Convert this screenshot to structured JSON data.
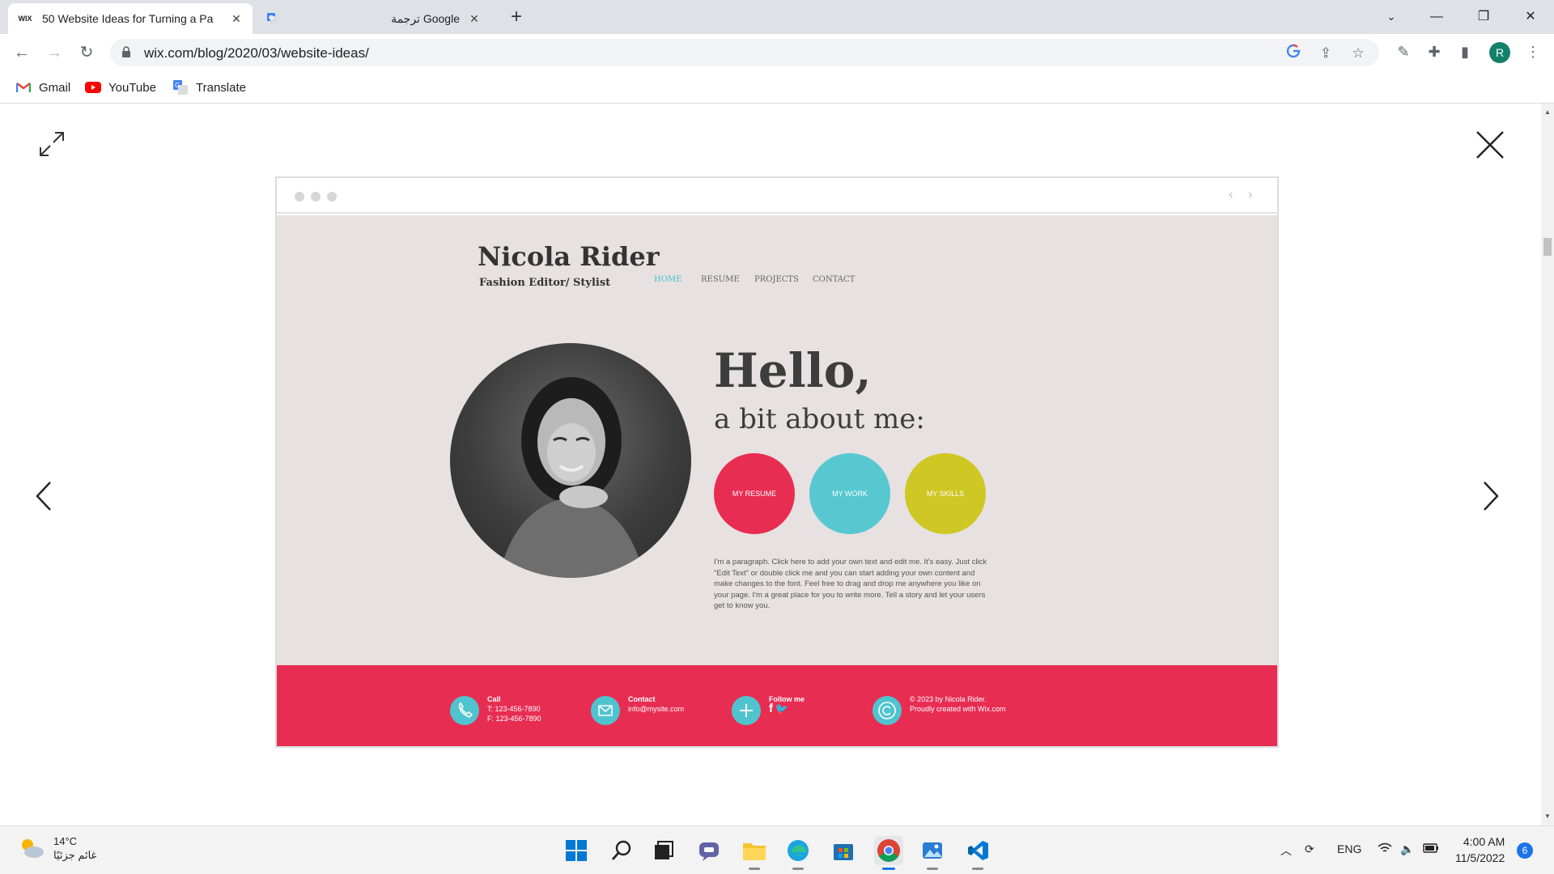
{
  "browser": {
    "tabs": [
      {
        "title": "50 Website Ideas for Turning a Pa",
        "favicon": "WIX",
        "active": true
      },
      {
        "title": "ترجمة Google",
        "favicon": "translate-icon",
        "active": false
      }
    ],
    "url": "wix.com/blog/2020/03/website-ideas/",
    "profile_initial": "R",
    "bookmarks": [
      {
        "label": "Gmail",
        "icon": "gmail-icon"
      },
      {
        "label": "YouTube",
        "icon": "youtube-icon"
      },
      {
        "label": "Translate",
        "icon": "translate-icon"
      }
    ]
  },
  "preview": {
    "site": {
      "name": "Nicola Rider",
      "subtitle": "Fashion Editor/ Stylist",
      "nav": [
        "HOME",
        "RESUME",
        "PROJECTS",
        "CONTACT"
      ],
      "heading": "Hello,",
      "subheading": "a bit about me:",
      "buttons": [
        {
          "label": "MY RESUME",
          "color": "#e82d52"
        },
        {
          "label": "MY WORK",
          "color": "#57c8d0"
        },
        {
          "label": "MY SKILLS",
          "color": "#cfc723"
        }
      ],
      "paragraph": "I'm a paragraph. Click here to add your own text and edit me. It's easy. Just click \"Edit Text\" or double click me and you can start adding your own content and make changes to the font. Feel free to drag and drop me anywhere you like on your page. I'm a great place for you to write more. Tell a story and let your users get to know you.",
      "footer": {
        "call_title": "Call",
        "call_t": "T: 123-456-7890",
        "call_f": "F: 123-456-7890",
        "contact_title": "Contact",
        "contact_email": "info@mysite.com",
        "follow_title": "Follow me",
        "copyright_1": "© 2023 by Nicola Rider.",
        "copyright_2": "Proudly created with Wix.com"
      }
    }
  },
  "taskbar": {
    "temperature": "14°C",
    "weather_desc": "غائم جزئيًا",
    "language": "ENG",
    "time": "4:00 AM",
    "date": "11/5/2022",
    "notifications": "6"
  },
  "colors": {
    "accent_pink": "#e82d52",
    "accent_teal": "#57c8d0",
    "accent_yellow": "#cfc723",
    "site_bg": "#e7e1e1"
  }
}
